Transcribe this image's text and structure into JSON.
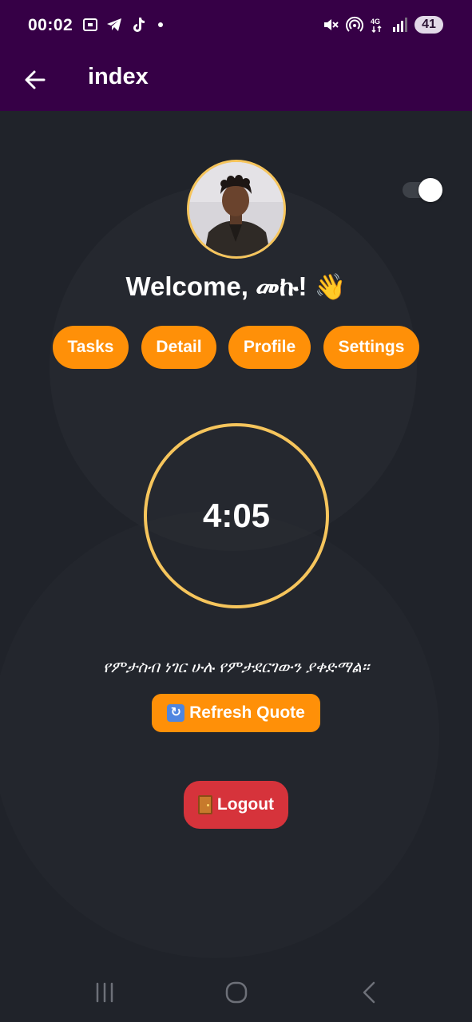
{
  "status_bar": {
    "time": "00:02",
    "battery": "41",
    "network": "4G"
  },
  "app_bar": {
    "title": "index"
  },
  "profile": {
    "welcome_text": "Welcome, መኩ!",
    "wave_emoji": "👋"
  },
  "nav_buttons": {
    "tasks": "Tasks",
    "detail": "Detail",
    "profile": "Profile",
    "settings": "Settings"
  },
  "timer": {
    "value": "4:05"
  },
  "quote": {
    "text": "የምታስብ ነገር ሁሉ የምታደርገውን ያቀድማል።",
    "refresh_label": "Refresh Quote",
    "refresh_icon": "🔄"
  },
  "logout": {
    "label": "Logout",
    "icon": "door-icon"
  },
  "toggle": {
    "state": "on"
  },
  "colors": {
    "app_bar": "#360046",
    "background": "#20232a",
    "accent_orange": "#ff9008",
    "ring_yellow": "#f6c55c",
    "logout_red": "#d6333b"
  }
}
